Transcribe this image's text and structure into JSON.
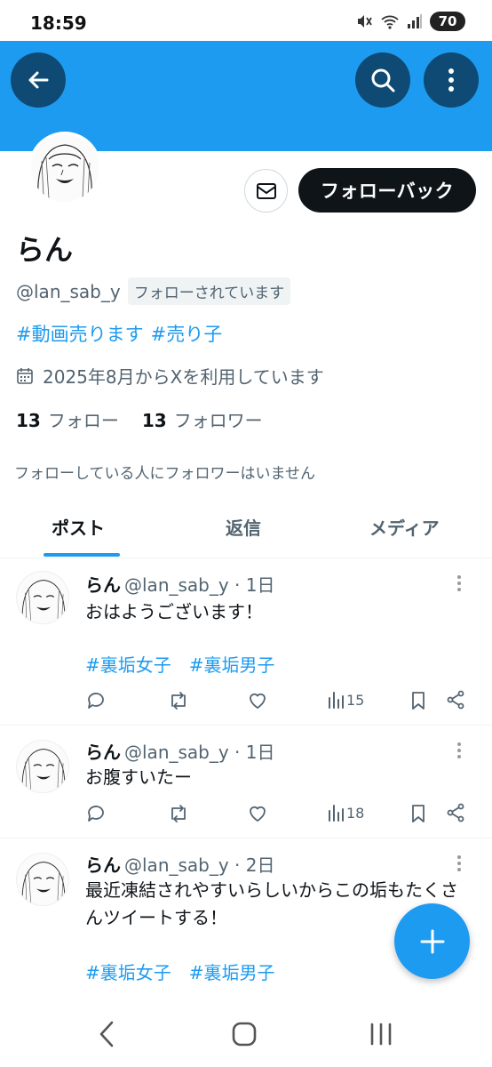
{
  "status_bar": {
    "time": "18:59",
    "battery": "70",
    "icons": [
      "mute-icon",
      "wifi-icon",
      "signal-icon",
      "battery-icon"
    ]
  },
  "header": {
    "back_icon": "arrow-left-icon",
    "search_icon": "search-icon",
    "more_icon": "more-vertical-icon",
    "banner_color": "#1d9bf0"
  },
  "profile": {
    "display_name": "らん",
    "handle": "@lan_sab_y",
    "follows_you": "フォローされています",
    "follow_back_label": "フォローバック",
    "bio_tags": [
      "#動画売ります",
      "#売り子"
    ],
    "joined": "2025年8月からXを利用しています",
    "following_count": "13",
    "following_label": "フォロー",
    "followers_count": "13",
    "followers_label": "フォロワー",
    "no_mutual": "フォローしている人にフォロワーはいません"
  },
  "tabs": [
    {
      "label": "ポスト",
      "active": true
    },
    {
      "label": "返信",
      "active": false
    },
    {
      "label": "メディア",
      "active": false
    }
  ],
  "posts": [
    {
      "name": "らん",
      "meta": "@lan_sab_y · 1日",
      "text": "おはようございます！",
      "tags": [
        "#裏垢女子",
        "#裏垢男子"
      ],
      "views": "15"
    },
    {
      "name": "らん",
      "meta": "@lan_sab_y · 1日",
      "text": "お腹すいたー",
      "tags": [],
      "views": "18"
    },
    {
      "name": "らん",
      "meta": "@lan_sab_y · 2日",
      "text": "最近凍結されやすいらしいからこの垢もたくさんツイートする！",
      "tags": [
        "#裏垢女子",
        "#裏垢男子"
      ],
      "views": ""
    }
  ],
  "fab_icon": "plus-icon",
  "nav": {
    "back_icon": "nav-back-icon",
    "home_icon": "nav-home-icon",
    "recents_icon": "nav-recents-icon"
  },
  "colors": {
    "accent": "#1d9bf0",
    "text_primary": "#0f1419",
    "text_secondary": "#536471"
  }
}
